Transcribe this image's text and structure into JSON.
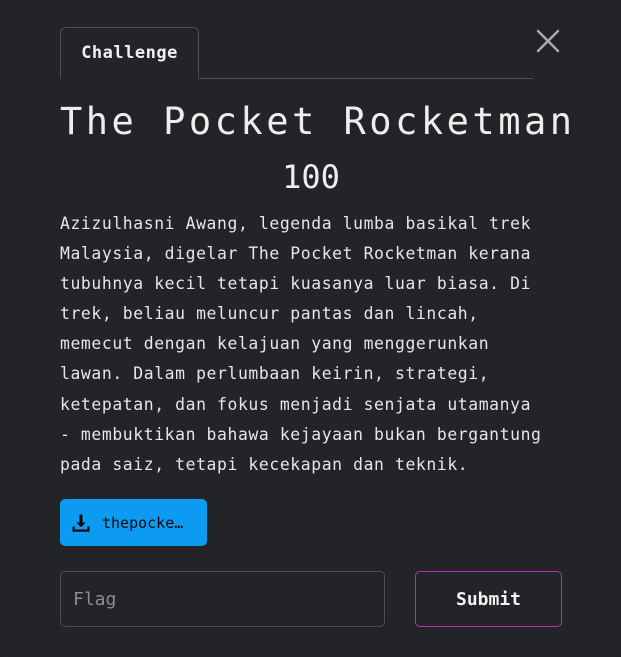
{
  "tabs": [
    {
      "label": "Challenge"
    }
  ],
  "challenge": {
    "title": "The Pocket Rocketman",
    "points": "100",
    "description_lines": [
      "Azizulhasni Awang, legenda lumba basikal trek",
      "Malaysia, digelar The Pocket Rocketman kerana",
      "tubuhnya kecil tetapi kuasanya luar biasa. Di",
      "trek, beliau meluncur pantas dan lincah,",
      "memecut dengan kelajuan yang menggerunkan",
      "lawan. Dalam perlumbaan keirin, strategi,",
      "ketepatan, dan fokus menjadi senjata utamanya",
      "- membuktikan bahawa kejayaan bukan bergantung",
      "pada saiz, tetapi kecekapan dan teknik."
    ],
    "file": {
      "label": "thepocke…",
      "icon": "download-icon"
    }
  },
  "flag_input": {
    "placeholder": "Flag",
    "value": ""
  },
  "submit_label": "Submit",
  "icons": {
    "close": "close-icon"
  },
  "colors": {
    "background": "#222428",
    "file_button": "#0d9bf2",
    "submit_border": "#b02fb8"
  }
}
